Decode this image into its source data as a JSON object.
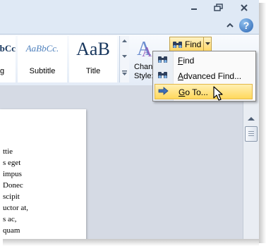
{
  "ribbon": {
    "styles": [
      {
        "sample": "AaBbCc",
        "label": "g"
      },
      {
        "sample": "AaBbCc.",
        "label": "Subtitle"
      },
      {
        "sample": "AaB",
        "label": "Title"
      }
    ],
    "change_styles": {
      "line1": "Chan",
      "line2": "Style:"
    },
    "find_button": {
      "label": "Find"
    }
  },
  "find_menu": {
    "items": [
      {
        "label_accel": "F",
        "label_rest": "ind",
        "icon": "binoculars-icon"
      },
      {
        "label_accel": "A",
        "label_rest": "dvanced Find...",
        "icon": "binoculars-icon"
      },
      {
        "label_accel": "G",
        "label_rest": "o To...",
        "icon": "arrow-right-icon",
        "highlighted": true
      }
    ]
  },
  "document": {
    "lines": [
      "ttie",
      "s eget",
      "impus",
      "Donec",
      "scipit",
      "uctor at,",
      "s  ac,",
      "quam"
    ]
  },
  "colors": {
    "ribbon_bg": "#e4ecf7",
    "highlight": "#ffd85c",
    "doc_bg": "#d5dae4"
  }
}
